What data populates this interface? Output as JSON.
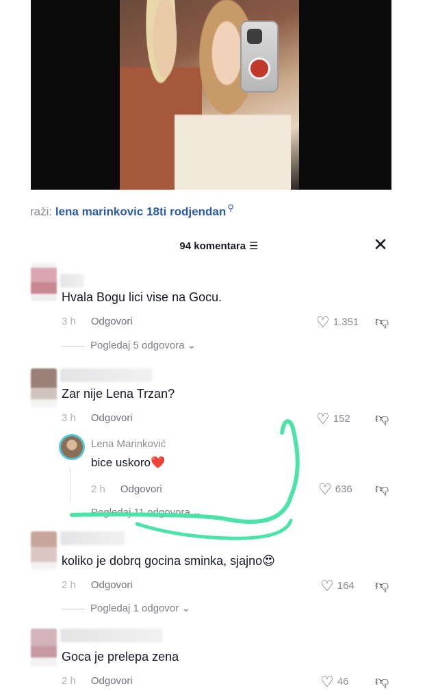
{
  "search": {
    "prefix": "raži:",
    "query": "lena marinkovic 18ti rodjendan",
    "icon": "search-icon"
  },
  "comments_header": {
    "count_label": "94 komentara",
    "filter_icon": "filter-icon",
    "close_icon": "close-icon"
  },
  "comments": [
    {
      "text": "Hvala Bogu lici vise na Gocu.",
      "time": "3 h",
      "reply_label": "Odgovori",
      "likes": "1.351",
      "view_replies": "Pogledaj 5 odgovora"
    },
    {
      "text": "Zar nije Lena Trzan?",
      "time": "3 h",
      "reply_label": "Odgovori",
      "likes": "152",
      "creator_reply": {
        "name": "Lena Marinković",
        "text": "bice uskoro",
        "emoji": "❤️",
        "time": "2 h",
        "reply_label": "Odgovori",
        "likes": "636"
      },
      "view_replies": "Pogledaj 11 odgovora"
    },
    {
      "text": "koliko je dobrq gocina sminka, sjajno",
      "emoji": "😍",
      "time": "2 h",
      "reply_label": "Odgovori",
      "likes": "164",
      "view_replies": "Pogledaj 1 odgovor"
    },
    {
      "text": "Goca je prelepa zena",
      "time": "2 h",
      "reply_label": "Odgovori",
      "likes": "46"
    }
  ],
  "colors": {
    "link_blue": "#2b5aa6",
    "annotation_green": "#4be3a8",
    "creator_ring": "#4fc7d9"
  }
}
